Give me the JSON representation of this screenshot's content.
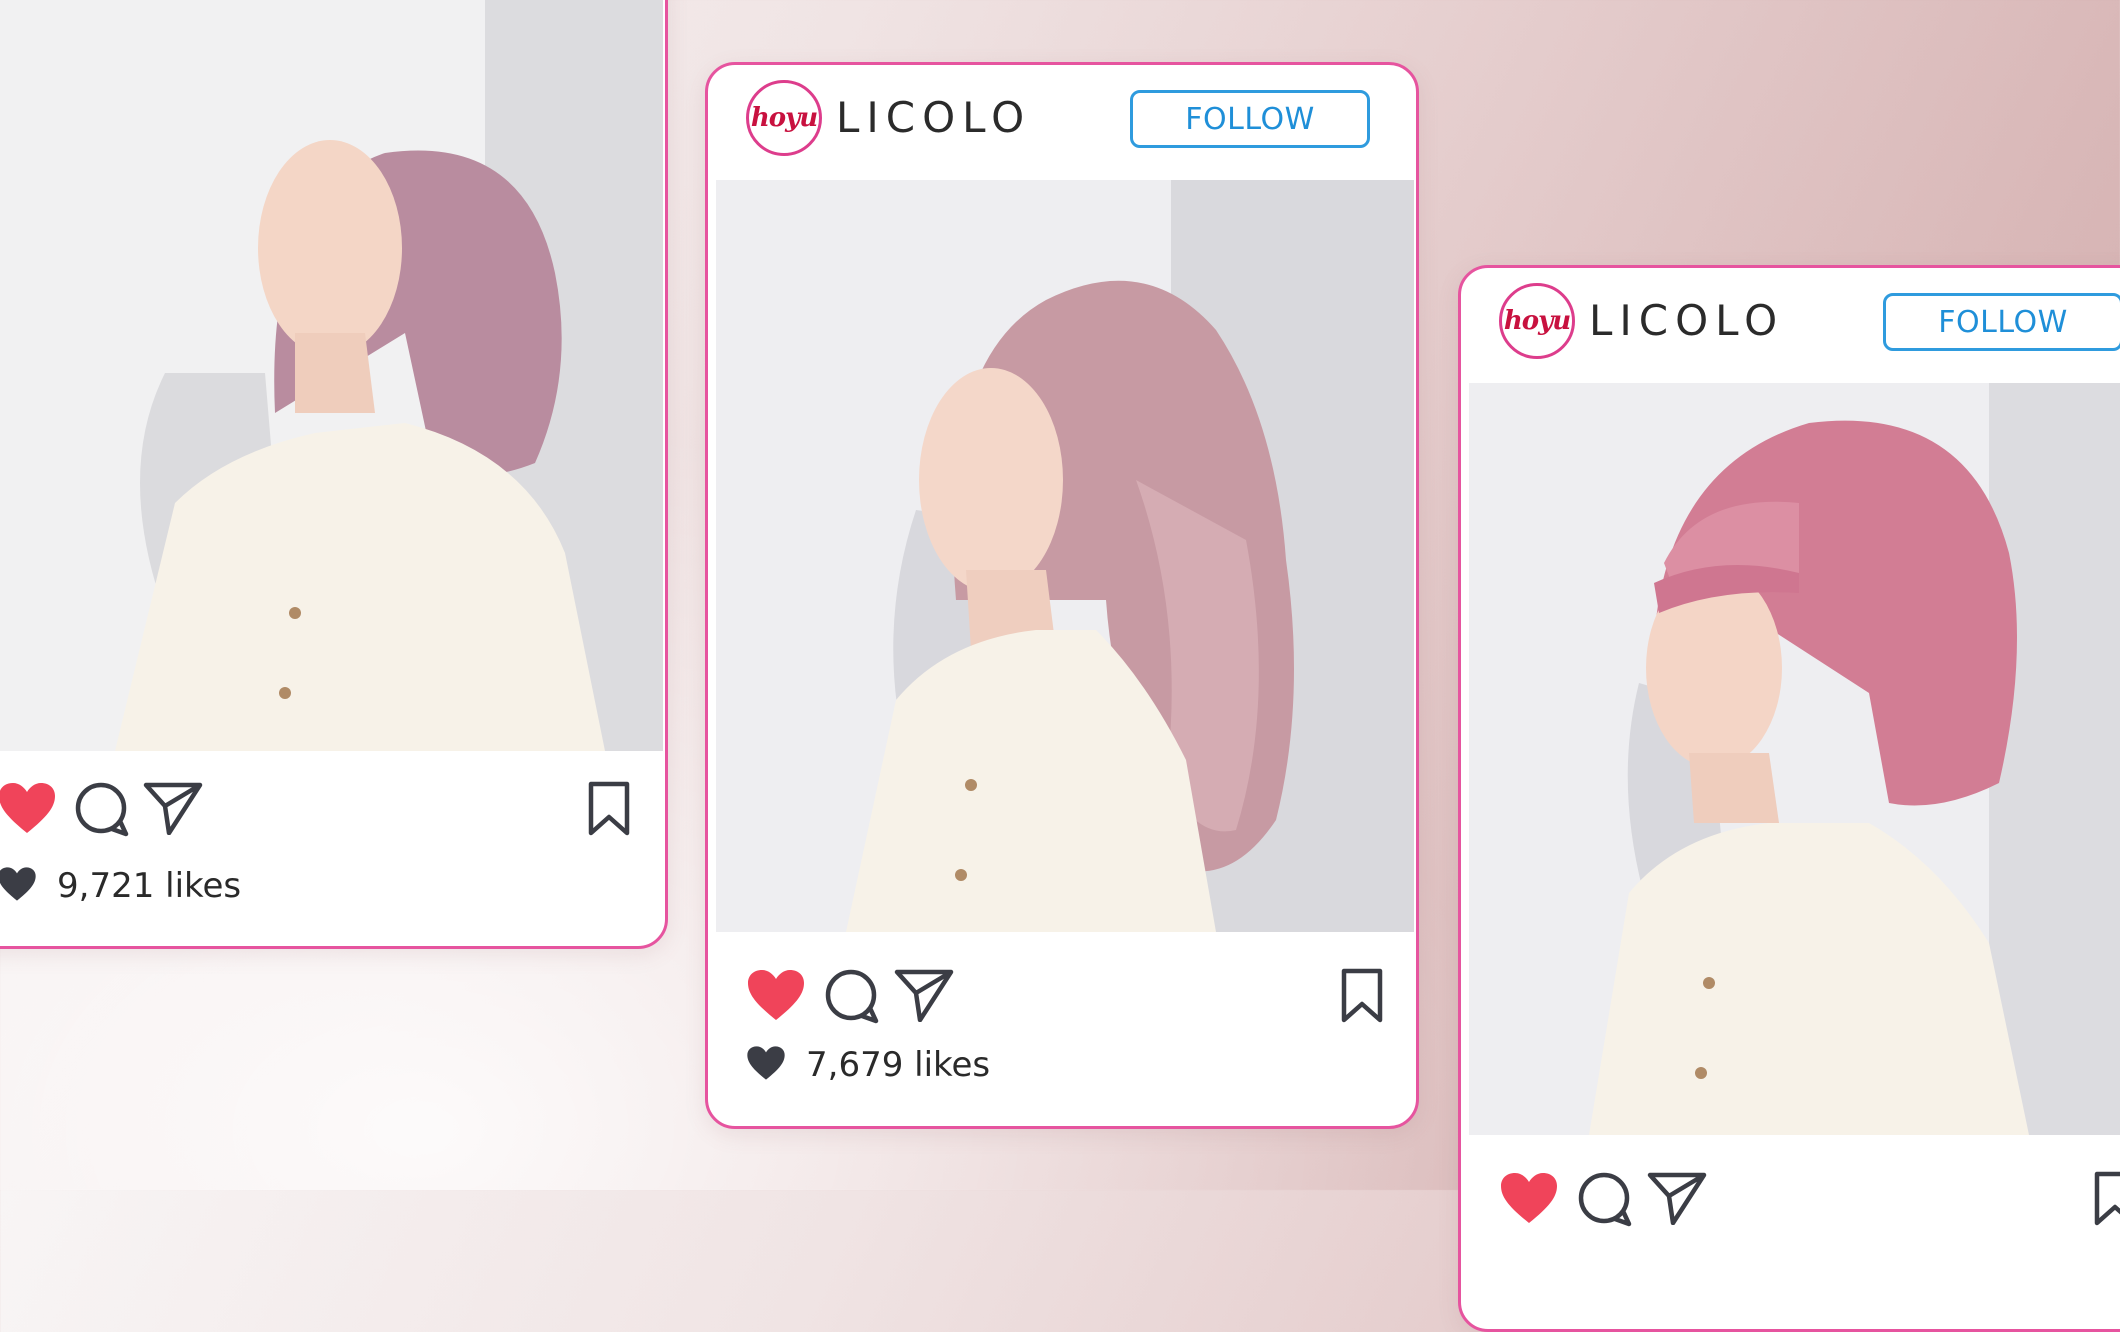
{
  "posts": [
    {
      "id": "left",
      "brand_logo_text": "",
      "brand_name": "",
      "follow_label": "",
      "likes": "9,721 likes",
      "photo": "woman with pastel lavender-pink straight bob, eyes closed, cream blouse",
      "hair_color": "#b98c9f"
    },
    {
      "id": "center",
      "brand_logo_text": "hoyu",
      "brand_name": "LICOLO",
      "follow_label": "FOLLOW",
      "likes": "7,679 likes",
      "photo": "woman with long wavy ash-pink hair, eyes closed, cream blouse",
      "hair_color": "#c79aa3"
    },
    {
      "id": "right",
      "brand_logo_text": "hoyu",
      "brand_name": "LICOLO",
      "follow_label": "FOLLOW",
      "likes": "",
      "photo": "woman with rose pink bob with bangs, eyes closed, cream blouse",
      "hair_color": "#d27d94"
    }
  ],
  "icons": {
    "like": "heart-icon",
    "comment": "comment-icon",
    "share": "send-icon",
    "save": "bookmark-icon",
    "likes_indicator": "small-heart-icon"
  },
  "colors": {
    "card_border": "#e6549f",
    "follow_blue": "#2f9bde",
    "like_red": "#f0445a",
    "brand_red": "#c8113f"
  }
}
